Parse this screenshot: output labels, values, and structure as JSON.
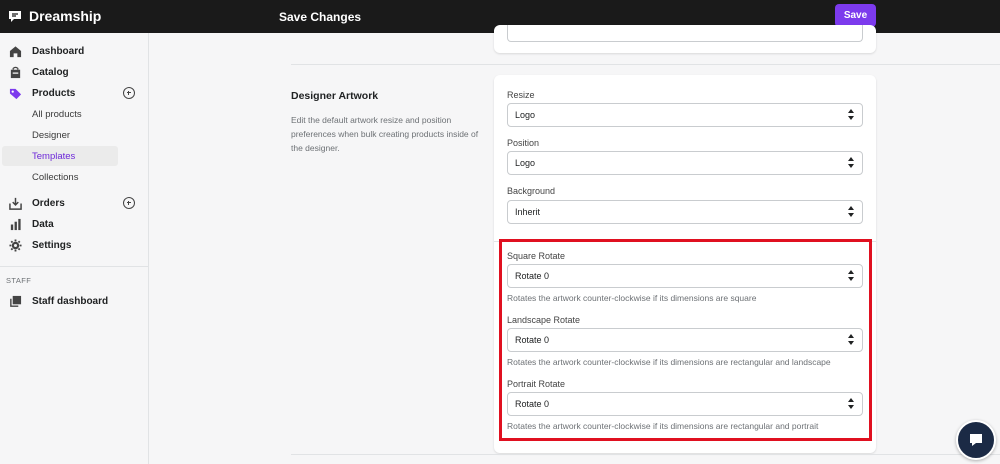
{
  "app": {
    "brand": "Dreamship",
    "topbar_title": "Save Changes",
    "save_label": "Save"
  },
  "sidebar": {
    "items": [
      {
        "label": "Dashboard",
        "icon": "home-icon"
      },
      {
        "label": "Catalog",
        "icon": "catalog-icon"
      },
      {
        "label": "Products",
        "icon": "tag-icon"
      },
      {
        "label": "Orders",
        "icon": "download-icon"
      },
      {
        "label": "Data",
        "icon": "bar-chart-icon"
      },
      {
        "label": "Settings",
        "icon": "gear-icon"
      }
    ],
    "products_sub": [
      "All products",
      "Designer",
      "Templates",
      "Collections"
    ],
    "active_sub": "Templates",
    "staff_label": "STAFF",
    "staff_item": "Staff dashboard"
  },
  "section": {
    "title": "Designer Artwork",
    "description": "Edit the default artwork resize and position preferences when bulk creating products inside of the designer."
  },
  "fields": {
    "resize": {
      "label": "Resize",
      "value": "Logo"
    },
    "position": {
      "label": "Position",
      "value": "Logo"
    },
    "background": {
      "label": "Background",
      "value": "Inherit"
    },
    "square_rotate": {
      "label": "Square Rotate",
      "value": "Rotate 0",
      "help": "Rotates the artwork counter-clockwise if its dimensions are square"
    },
    "landscape_rotate": {
      "label": "Landscape Rotate",
      "value": "Rotate 0",
      "help": "Rotates the artwork counter-clockwise if its dimensions are rectangular and landscape"
    },
    "portrait_rotate": {
      "label": "Portrait Rotate",
      "value": "Rotate 0",
      "help": "Rotates the artwork counter-clockwise if its dimensions are rectangular and portrait"
    }
  },
  "colors": {
    "accent": "#7c3aed",
    "highlight": "#e01020",
    "topbar": "#1a1a1a"
  }
}
